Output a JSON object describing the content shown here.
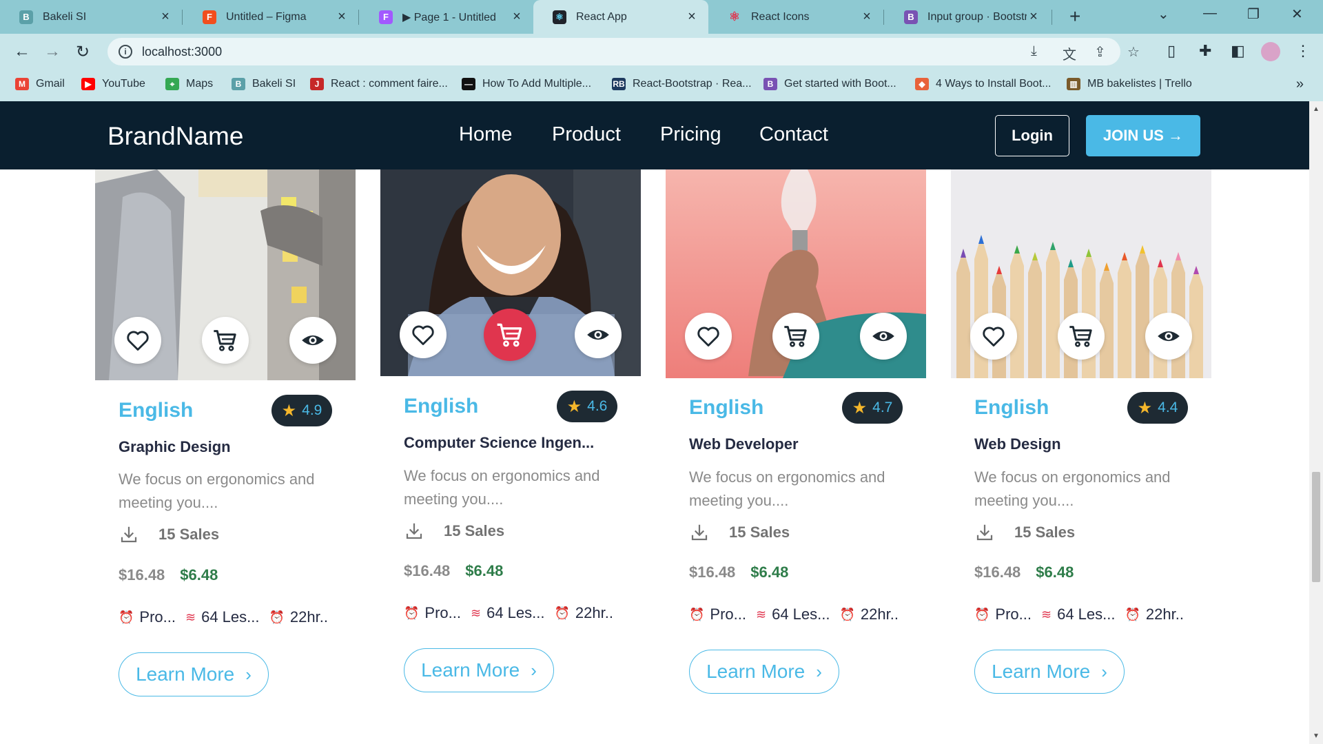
{
  "browser": {
    "tabs": [
      {
        "title": "Bakeli SI",
        "color": "#5ba0a8"
      },
      {
        "title": "Untitled – Figma",
        "color": "#f24e1e"
      },
      {
        "title": "▶ Page 1 - Untitled",
        "color": "#a259ff"
      },
      {
        "title": "React App",
        "color": "#20232a"
      },
      {
        "title": "React Icons",
        "color": "#e0354e"
      },
      {
        "title": "Input group · Bootstrap",
        "color": "#7952b3"
      }
    ],
    "active_tab": 3,
    "url": "localhost:3000",
    "bookmarks": [
      {
        "label": "Gmail",
        "color": "#ea4335"
      },
      {
        "label": "YouTube",
        "color": "#ff0000"
      },
      {
        "label": "Maps",
        "color": "#34a853"
      },
      {
        "label": "Bakeli SI",
        "color": "#5ba0a8"
      },
      {
        "label": "React : comment faire...",
        "color": "#c62828"
      },
      {
        "label": "How To Add Multiple...",
        "color": "#111111"
      },
      {
        "label": "React-Bootstrap · Rea...",
        "color": "#1e3a5f"
      },
      {
        "label": "Get started with Boot...",
        "color": "#7952b3"
      },
      {
        "label": "4 Ways to Install Boot...",
        "color": "#e8623a"
      },
      {
        "label": "MB bakelistes | Trello",
        "color": "#7a5a2a"
      }
    ]
  },
  "navbar": {
    "brand": "BrandName",
    "links": [
      "Home",
      "Product",
      "Pricing",
      "Contact"
    ],
    "login": "Login",
    "join": "JOIN US →"
  },
  "cards": [
    {
      "category": "English",
      "rating": "4.9",
      "title": "Graphic Design",
      "desc": "We focus on ergonomics and meeting you....",
      "sales": "15 Sales",
      "old_price": "$16.48",
      "new_price": "$6.48",
      "meta1": "Pro...",
      "meta2": "64 Les...",
      "meta3": "22hr..",
      "button": "Learn More"
    },
    {
      "category": "English",
      "rating": "4.6",
      "title": "Computer Science Ingen...",
      "desc": "We focus on ergonomics and meeting you....",
      "sales": "15 Sales",
      "old_price": "$16.48",
      "new_price": "$6.48",
      "meta1": "Pro...",
      "meta2": "64 Les...",
      "meta3": "22hr..",
      "button": "Learn More"
    },
    {
      "category": "English",
      "rating": "4.7",
      "title": "Web Developer",
      "desc": "We focus on ergonomics and meeting you....",
      "sales": "15 Sales",
      "old_price": "$16.48",
      "new_price": "$6.48",
      "meta1": "Pro...",
      "meta2": "64 Les...",
      "meta3": "22hr..",
      "button": "Learn More"
    },
    {
      "category": "English",
      "rating": "4.4",
      "title": "Web Design",
      "desc": "We focus on ergonomics and meeting you....",
      "sales": "15 Sales",
      "old_price": "$16.48",
      "new_price": "$6.48",
      "meta1": "Pro...",
      "meta2": "64 Les...",
      "meta3": "22hr..",
      "button": "Learn More"
    }
  ],
  "colors": {
    "nav_bg": "#0a1f2f",
    "accent": "#4ab9e6",
    "cart_active": "#e0354e",
    "price_new": "#2f7d4a"
  },
  "icons": [
    "heart-icon",
    "cart-icon",
    "eye-icon",
    "download-icon",
    "star-icon",
    "alarm-clock-icon",
    "waves-icon",
    "chevron-right-icon"
  ]
}
